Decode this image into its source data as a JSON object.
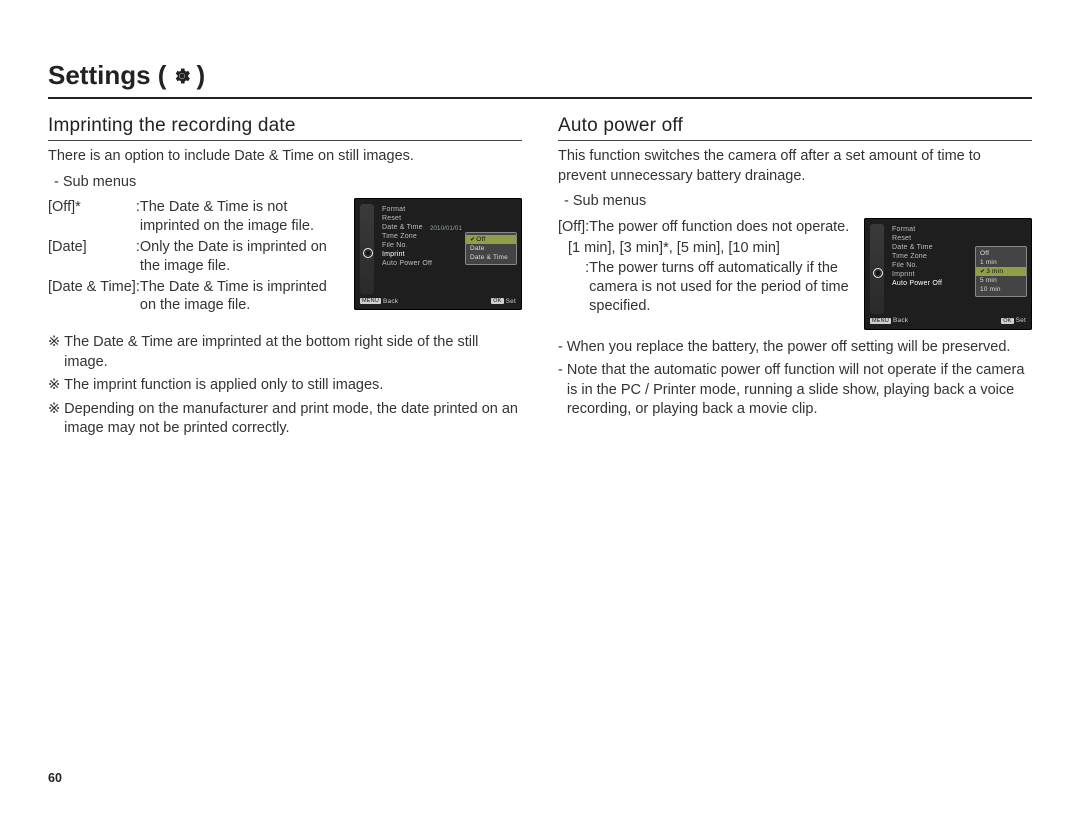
{
  "page": {
    "title_prefix": "Settings (",
    "title_suffix": " )",
    "gear_icon": "gear-icon",
    "page_number": "60"
  },
  "left": {
    "heading": "Imprinting the recording date",
    "intro": "There is an option to include Date & Time on still images.",
    "submenus_label": "- Sub menus",
    "items": [
      {
        "key": "[Off]*",
        "desc": "The Date & Time is not imprinted on the image file."
      },
      {
        "key": "[Date]",
        "desc": "Only the Date is imprinted on the image file."
      },
      {
        "key": "[Date & Time]",
        "desc": "The Date & Time is imprinted on the image file."
      }
    ],
    "notes": [
      "The Date & Time are imprinted at the bottom right side of the still image.",
      "The imprint function is applied only to still images.",
      "Depending on the manufacturer and print mode, the date printed on an image may not be printed correctly."
    ],
    "note_marker": "※",
    "screenshot": {
      "menu_items": [
        "Format",
        "Reset",
        "Date & Time",
        "Time Zone",
        "File No.",
        "Imprint",
        "Auto Power Off"
      ],
      "highlight_index": 5,
      "popup": [
        "Off",
        "Date",
        "Date & Time"
      ],
      "popup_selected_index": 0,
      "extra_date": "2010/01/01",
      "bottom_left_key": "MENU",
      "bottom_left": "Back",
      "bottom_right_key": "OK",
      "bottom_right": "Set"
    }
  },
  "right": {
    "heading": "Auto power off",
    "intro": "This function switches the camera off after a set amount of time to prevent unnecessary battery drainage.",
    "submenus_label": "- Sub menus",
    "items": [
      {
        "key": "[Off]",
        "desc": "The power off function does not operate."
      },
      {
        "key": "[1 min], [3 min]*, [5 min], [10 min]",
        "desc": "The power turns off automatically if the camera is not used for the period of time specified."
      }
    ],
    "notes": [
      "When you replace the battery, the power off setting will be preserved.",
      "Note that the automatic power off function will not operate if the camera is in the PC / Printer mode, running a slide show, playing back a voice recording, or playing back a movie clip."
    ],
    "note_marker": "-",
    "screenshot": {
      "menu_items": [
        "Format",
        "Reset",
        "Date & Time",
        "Time Zone",
        "File No.",
        "Imprint",
        "Auto Power Off"
      ],
      "highlight_index": 6,
      "popup": [
        "Off",
        "1 min",
        "3 min",
        "5 min",
        "10 min"
      ],
      "popup_selected_index": 2,
      "bottom_left_key": "MENU",
      "bottom_left": "Back",
      "bottom_right_key": "OK",
      "bottom_right": "Set"
    }
  }
}
